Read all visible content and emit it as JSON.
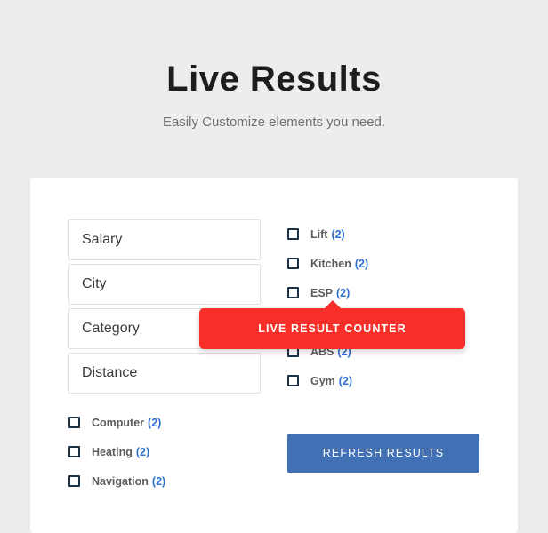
{
  "header": {
    "title": "Live Results",
    "subtitle": "Easily Customize elements you need."
  },
  "form": {
    "fields": [
      {
        "name": "salary",
        "placeholder": "Salary",
        "value": ""
      },
      {
        "name": "city",
        "placeholder": "City",
        "value": ""
      },
      {
        "name": "category",
        "placeholder": "Category",
        "value": ""
      },
      {
        "name": "distance",
        "placeholder": "Distance",
        "value": ""
      }
    ]
  },
  "left_checkboxes": [
    {
      "label": "Computer",
      "count": "(2)",
      "checked": false
    },
    {
      "label": "Heating",
      "count": "(2)",
      "checked": false
    },
    {
      "label": "Navigation",
      "count": "(2)",
      "checked": false
    }
  ],
  "right_checkboxes": [
    {
      "label": "Lift",
      "count": "(2)",
      "checked": false
    },
    {
      "label": "Kitchen",
      "count": "(2)",
      "checked": false
    },
    {
      "label": "ESP",
      "count": "(2)",
      "checked": false
    },
    {
      "label": "ABS",
      "count": "(2)",
      "checked": false
    },
    {
      "label": "Gym",
      "count": "(2)",
      "checked": false
    }
  ],
  "refresh_button": {
    "label": "REFRESH RESULTS"
  },
  "tooltip": {
    "label": "LIVE RESULT COUNTER"
  },
  "colors": {
    "page_background": "#ededed",
    "card_background": "#ffffff",
    "accent_blue": "#4170b4",
    "count_blue": "#2f6fd0",
    "tooltip_red": "#f82e28",
    "title_text": "#1d1d1f",
    "subtitle_text": "#6f7175",
    "label_text": "#5a5c60",
    "checkbox_border": "#1d3244",
    "input_border": "#e2e2e2"
  }
}
